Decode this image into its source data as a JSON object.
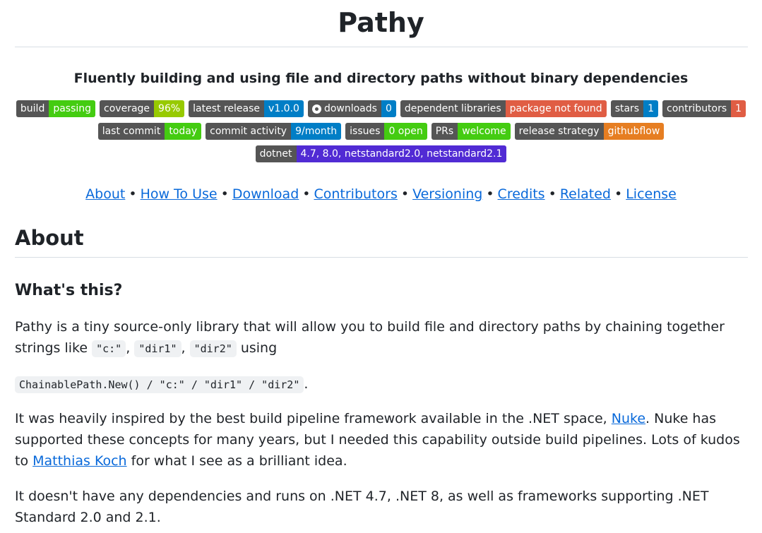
{
  "title": "Pathy",
  "subtitle": "Fluently building and using file and directory paths without binary dependencies",
  "badges": [
    {
      "label": "build",
      "value": "passing",
      "color": "#4c1"
    },
    {
      "label": "coverage",
      "value": "96%",
      "color": "#97ca00"
    },
    {
      "label": "latest release",
      "value": "v1.0.0",
      "color": "#007ec6"
    },
    {
      "label": "downloads",
      "value": "0",
      "color": "#007ec6",
      "icon": "nuget-icon"
    },
    {
      "label": "dependent libraries",
      "value": "package not found",
      "color": "#e05d44"
    },
    {
      "label": "stars",
      "value": "1",
      "color": "#007ec6"
    },
    {
      "label": "contributors",
      "value": "1",
      "color": "#e05d44"
    },
    {
      "label": "last commit",
      "value": "today",
      "color": "#4c1"
    },
    {
      "label": "commit activity",
      "value": "9/month",
      "color": "#007ec6"
    },
    {
      "label": "issues",
      "value": "0 open",
      "color": "#4c1"
    },
    {
      "label": "PRs",
      "value": "welcome",
      "color": "#4c1"
    },
    {
      "label": "release strategy",
      "value": "githubflow",
      "color": "#e67e22"
    },
    {
      "label": "dotnet",
      "value": "4.7, 8.0, netstandard2.0, netstandard2.1",
      "color": "#512bd4"
    }
  ],
  "nav": [
    "About",
    "How To Use",
    "Download",
    "Contributors",
    "Versioning",
    "Credits",
    "Related",
    "License"
  ],
  "nav_separator": "•",
  "about_heading": "About",
  "whats_this_heading": "What's this?",
  "p1": {
    "text_before": "Pathy is a tiny source-only library that will allow you to build file and directory paths by chaining together strings like ",
    "code1": "\"c:\"",
    "comma1": ", ",
    "code2": "\"dir1\"",
    "comma2": ", ",
    "code3": "\"dir2\"",
    "text_after": " using"
  },
  "p2": {
    "code": "ChainablePath.New() / \"c:\" / \"dir1\" / \"dir2\"",
    "text_after": "."
  },
  "p3": {
    "text1": "It was heavily inspired by the best build pipeline framework available in the .NET space, ",
    "link1": "Nuke",
    "text2": ". Nuke has supported these concepts for many years, but I needed this capability outside build pipelines. Lots of kudos to ",
    "link2": "Matthias Koch",
    "text3": " for what I see as a brilliant idea."
  },
  "p4": "It doesn't have any dependencies and runs on .NET 4.7, .NET 8, as well as frameworks supporting .NET Standard 2.0 and 2.1."
}
